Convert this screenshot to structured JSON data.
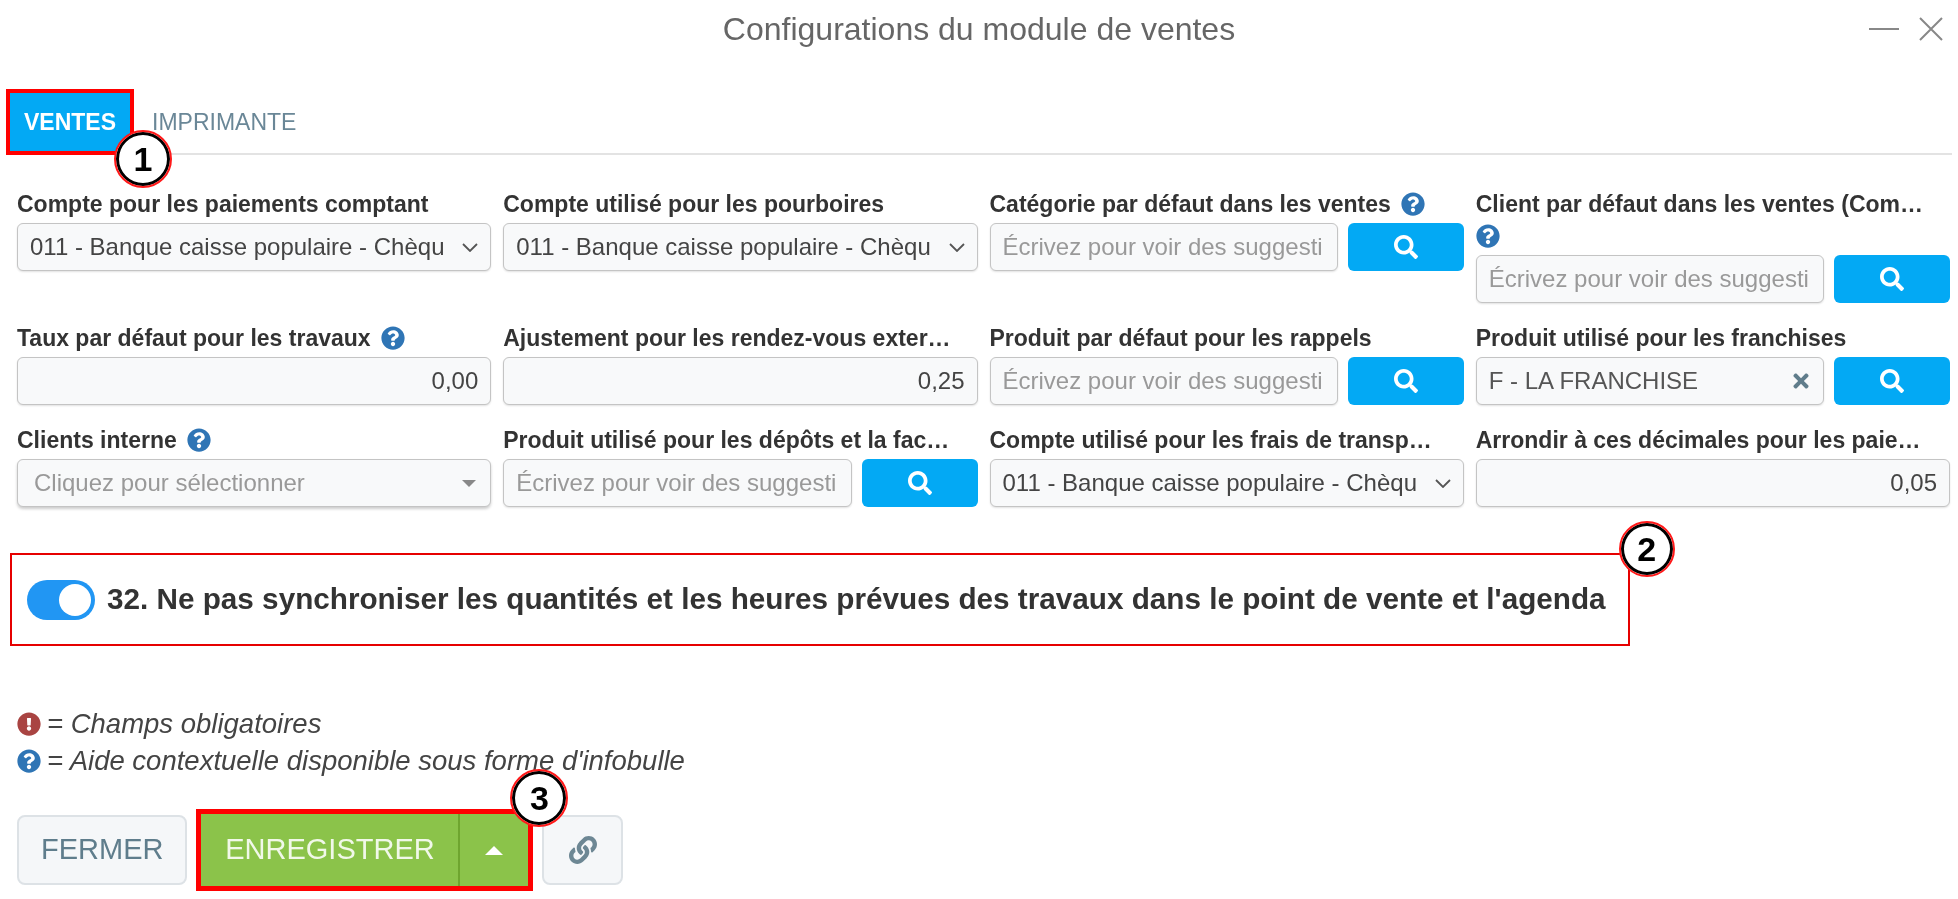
{
  "window": {
    "title": "Configurations du module de ventes"
  },
  "tabs": [
    {
      "label": "VENTES",
      "selected": true
    },
    {
      "label": "IMPRIMANTE",
      "selected": false
    }
  ],
  "fields": [
    {
      "kind": "select",
      "label": "Compte pour les paiements comptant",
      "help": false,
      "value": "011 - Banque caisse populaire - Chèqu"
    },
    {
      "kind": "select",
      "label": "Compte utilisé pour les pourboires",
      "help": false,
      "value": "011 - Banque caisse populaire - Chèqu"
    },
    {
      "kind": "search",
      "label": "Catégorie par défaut dans les ventes",
      "help": true,
      "placeholder": "Écrivez pour voir des suggesti",
      "clearable": false
    },
    {
      "kind": "search",
      "label": "Client par défaut dans les ventes (Com…",
      "help": true,
      "placeholder": "Écrivez pour voir des suggesti",
      "clearable": false
    },
    {
      "kind": "number",
      "label": "Taux par défaut pour les travaux",
      "help": true,
      "value": "0,00"
    },
    {
      "kind": "number",
      "label": "Ajustement pour les rendez-vous exter…",
      "help": false,
      "value": "0,25"
    },
    {
      "kind": "search",
      "label": "Produit par défaut pour les rappels",
      "help": false,
      "placeholder": "Écrivez pour voir des suggesti",
      "clearable": false
    },
    {
      "kind": "search",
      "label": "Produit utilisé pour les franchises",
      "help": false,
      "value": "F - LA FRANCHISE",
      "clearable": true
    },
    {
      "kind": "dropdown",
      "label": "Clients interne",
      "help": true,
      "placeholder": "Cliquez pour sélectionner"
    },
    {
      "kind": "search",
      "label": "Produit utilisé pour les dépôts et la fac…",
      "help": false,
      "placeholder": "Écrivez pour voir des suggesti",
      "clearable": false
    },
    {
      "kind": "select",
      "label": "Compte utilisé pour les frais de transp…",
      "help": false,
      "value": "011 - Banque caisse populaire - Chèqu"
    },
    {
      "kind": "number",
      "label": "Arrondir à ces décimales pour les paie…",
      "help": false,
      "value": "0,05"
    }
  ],
  "toggle": {
    "on": true,
    "label": "32. Ne pas synchroniser les quantités et les heures prévues des travaux dans le point de vente et l'agenda"
  },
  "legend": [
    {
      "kind": "required",
      "text": "= Champs obligatoires"
    },
    {
      "kind": "help",
      "text": "= Aide contextuelle disponible sous forme d'infobulle"
    }
  ],
  "buttons": [
    {
      "kind": "close",
      "label": "FERMER"
    },
    {
      "kind": "save",
      "label": "ENREGISTRER"
    },
    {
      "kind": "menu"
    },
    {
      "kind": "link"
    }
  ],
  "annotations": [
    "1",
    "2",
    "3"
  ]
}
